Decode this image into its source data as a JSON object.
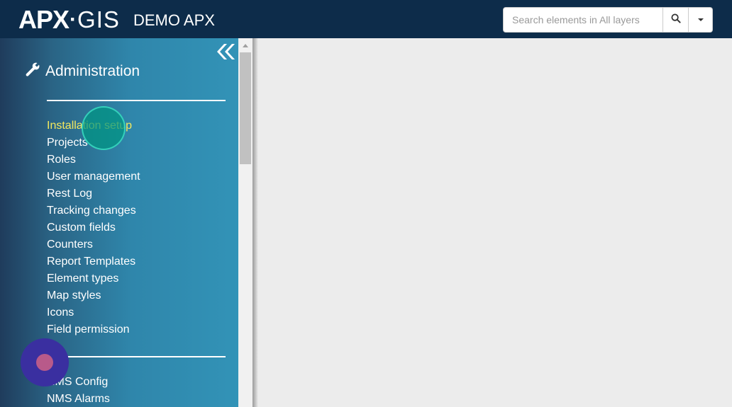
{
  "header": {
    "logo": {
      "apx": "APX",
      "dot": "·",
      "gis": "GIS"
    },
    "project_name": "DEMO APX",
    "search": {
      "placeholder": "Search elements in All layers",
      "value": ""
    },
    "search_button_icon": "search-icon",
    "dropdown_icon": "caret-down-icon",
    "background": "#0d2c4a"
  },
  "sidebar": {
    "collapse_icon": "double-chevron-left-icon",
    "section_icon": "wrench-icon",
    "section_title": "Administration",
    "items": [
      {
        "label": "Installation setup",
        "active": true
      },
      {
        "label": "Projects"
      },
      {
        "label": "Roles"
      },
      {
        "label": "User management"
      },
      {
        "label": "Rest Log"
      },
      {
        "label": "Tracking changes"
      },
      {
        "label": "Custom fields"
      },
      {
        "label": "Counters"
      },
      {
        "label": "Report Templates"
      },
      {
        "label": "Element types"
      },
      {
        "label": "Map styles"
      },
      {
        "label": "Icons"
      },
      {
        "label": "Field permission"
      }
    ],
    "items_2": [
      {
        "label": "NMS Config"
      },
      {
        "label": "NMS Alarms"
      }
    ],
    "active_color": "#f4e95e"
  }
}
